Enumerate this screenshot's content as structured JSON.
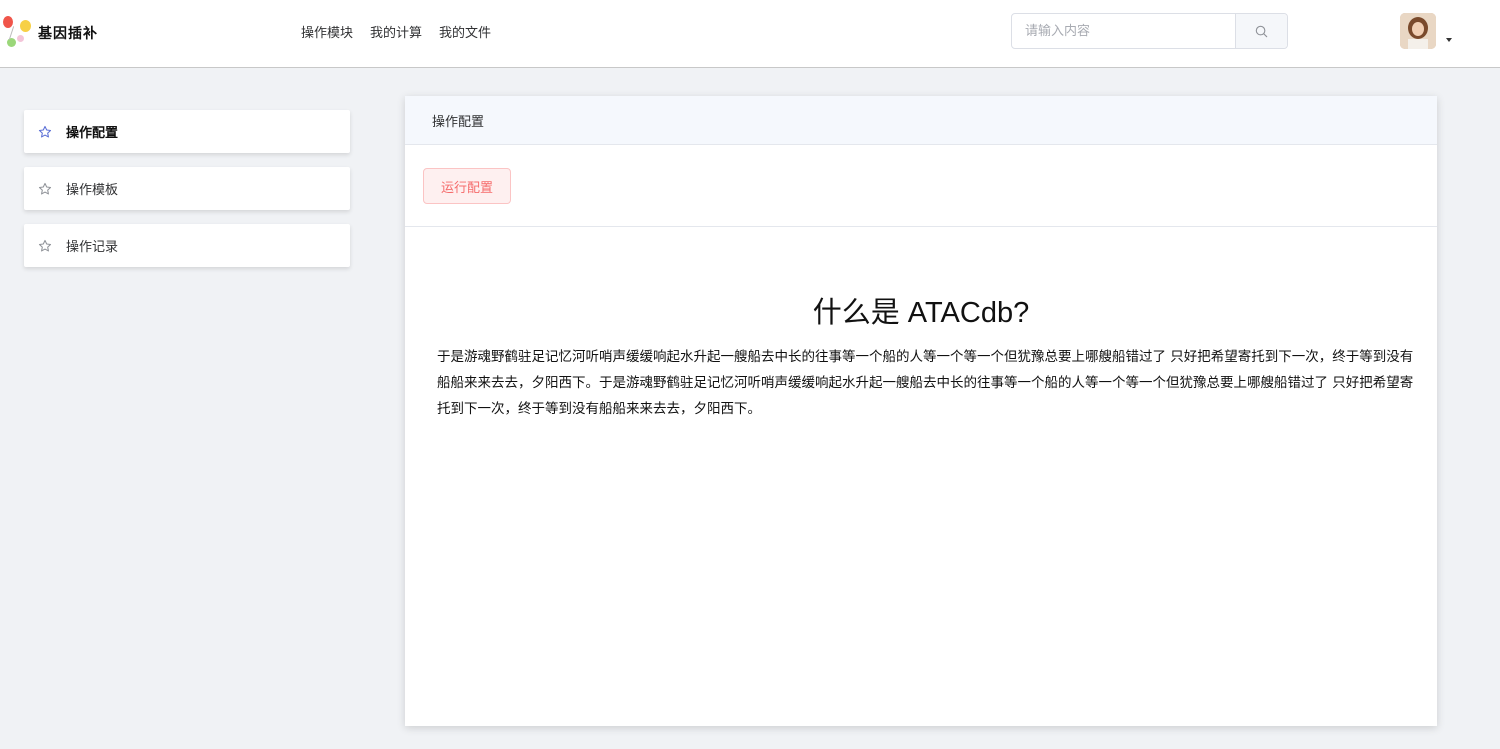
{
  "header": {
    "logo_text": "基因插补",
    "nav": [
      "操作模块",
      "我的计算",
      "我的文件"
    ],
    "search_placeholder": "请输入内容"
  },
  "sidebar": {
    "items": [
      {
        "label": "操作配置",
        "active": true
      },
      {
        "label": "操作模板",
        "active": false
      },
      {
        "label": "操作记录",
        "active": false
      }
    ]
  },
  "main": {
    "card_title": "操作配置",
    "run_button": "运行配置",
    "content_title": "什么是 ATACdb?",
    "content_body": "于是游魂野鹤驻足记忆河听哨声缓缓响起水升起一艘船去中长的往事等一个船的人等一个等一个但犹豫总要上哪艘船错过了 只好把希望寄托到下一次，终于等到没有船船来来去去，夕阳西下。于是游魂野鹤驻足记忆河听哨声缓缓响起水升起一艘船去中长的往事等一个船的人等一个等一个但犹豫总要上哪艘船错过了 只好把希望寄托到下一次，终于等到没有船船来来去去，夕阳西下。"
  },
  "colors": {
    "accent_star": "#5b6fd6",
    "run_button_text": "#f56c6c",
    "run_button_bg": "#fef0f0"
  },
  "icons": {
    "search": "search-icon",
    "sidebar": "star-icon",
    "user_menu": "caret-down-icon"
  }
}
